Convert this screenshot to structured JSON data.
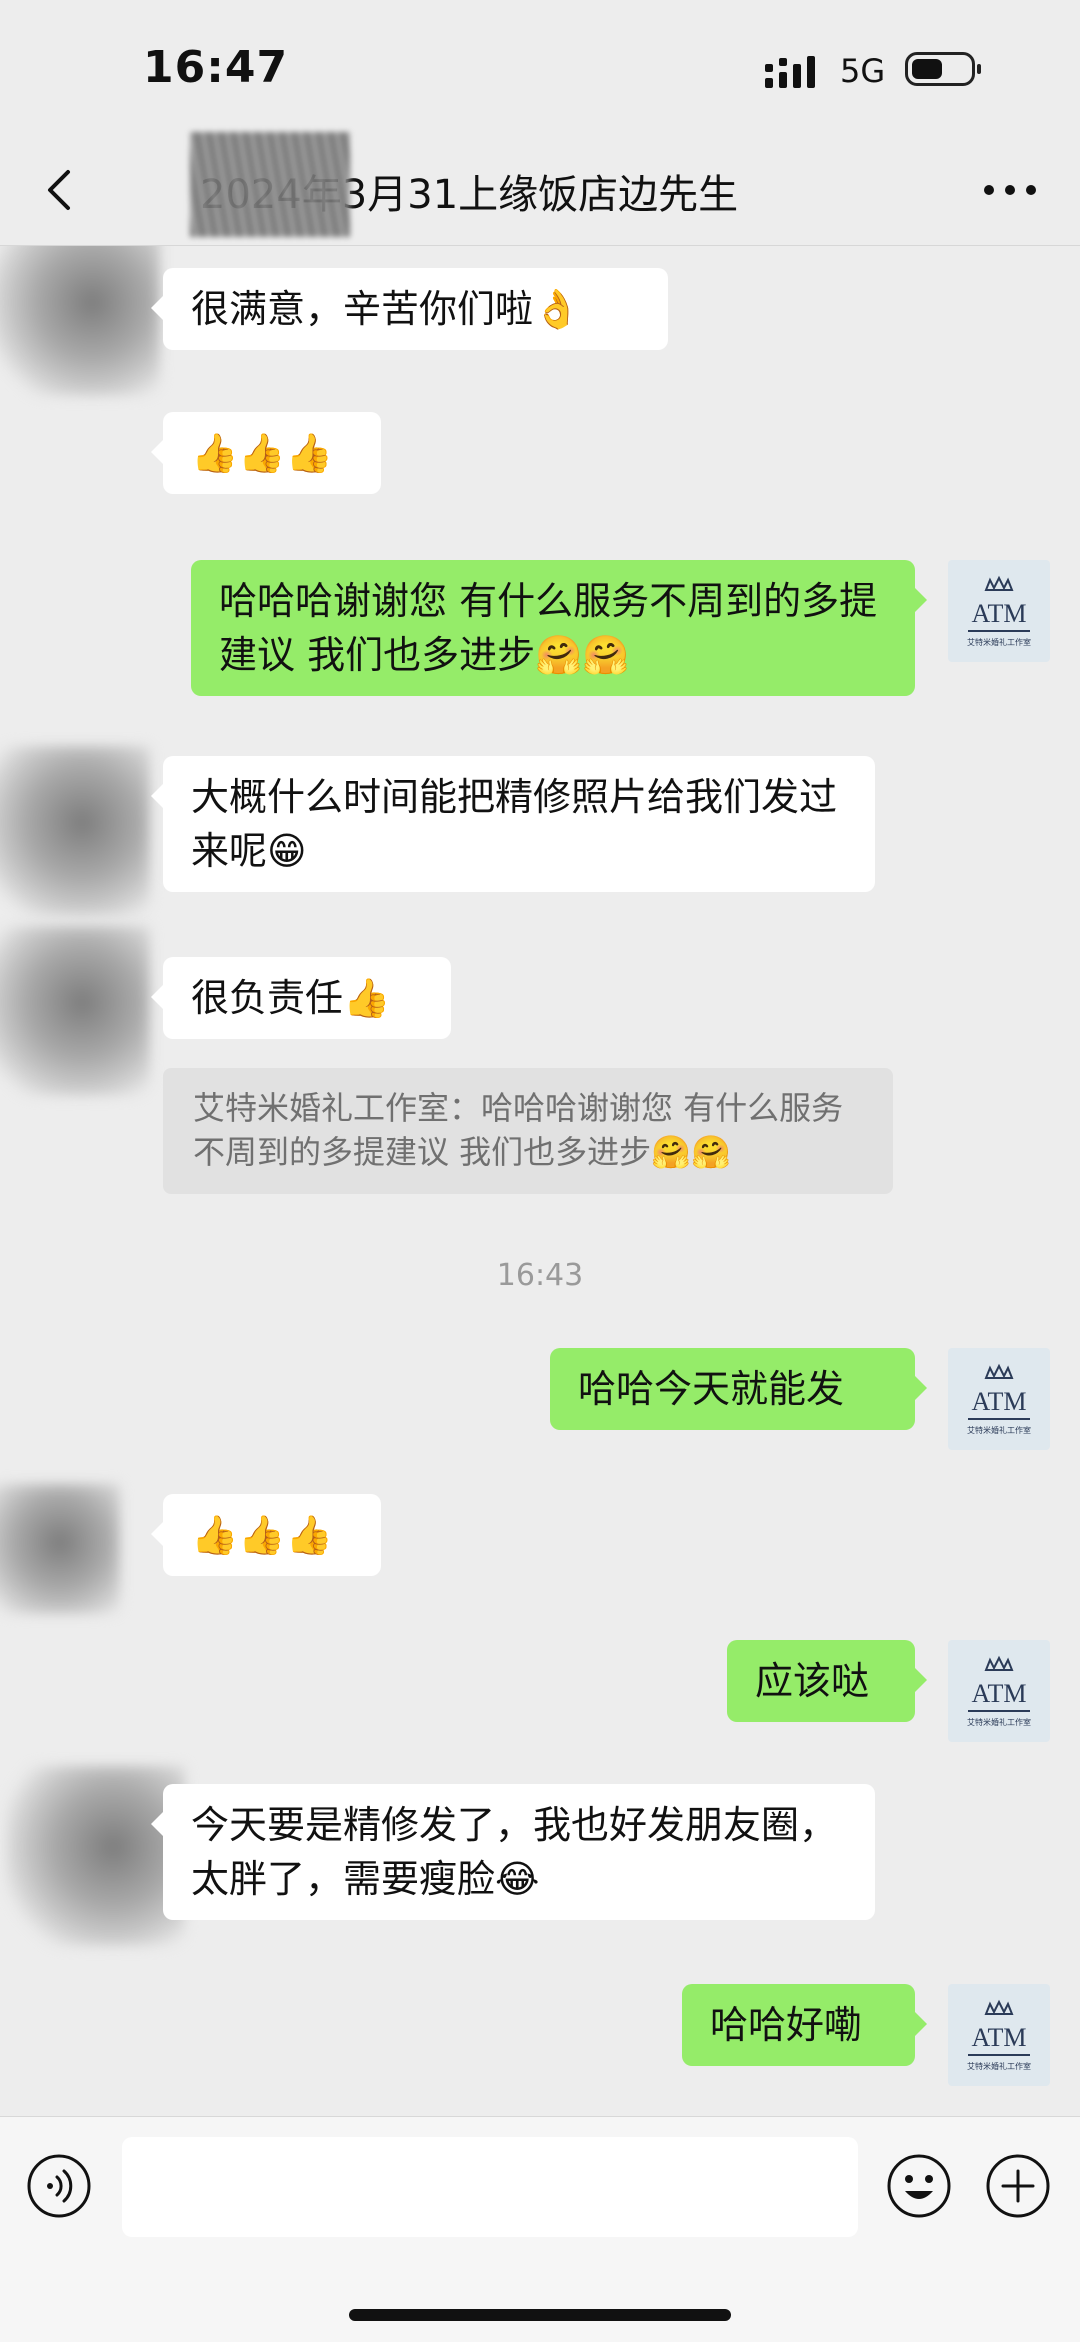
{
  "status": {
    "time": "16:47",
    "network": "5G"
  },
  "header": {
    "title": "2024年3月31上缘饭店边先生"
  },
  "avatar_logo": {
    "monogram": "ATM",
    "caption": "艾特米婚礼工作室"
  },
  "messages": {
    "m1": {
      "text": "很满意，辛苦你们啦👌"
    },
    "m2": {
      "text": "👍👍👍"
    },
    "m3": {
      "text": "哈哈哈谢谢您 有什么服务不周到的多提建议 我们也多进步🤗🤗"
    },
    "m4": {
      "text": "大概什么时间能把精修照片给我们发过来呢😁"
    },
    "m5": {
      "text": "很负责任👍"
    },
    "quote": {
      "text": "艾特米婚礼工作室：哈哈哈谢谢您 有什么服务不周到的多提建议 我们也多进步🤗🤗"
    },
    "timestamp": "16:43",
    "m6": {
      "text": "哈哈今天就能发"
    },
    "m7": {
      "text": "👍👍👍"
    },
    "m8": {
      "text": "应该哒"
    },
    "m9": {
      "text": "今天要是精修发了，我也好发朋友圈，太胖了，需要瘦脸😂"
    },
    "m10": {
      "text": "哈哈好嘞"
    }
  },
  "input": {
    "value": "",
    "placeholder": ""
  },
  "colors": {
    "sent_bubble": "#95ec69",
    "received_bubble": "#ffffff",
    "chat_bg": "#ededed"
  },
  "icons": [
    "signal-icon",
    "battery-icon",
    "back-icon",
    "more-icon",
    "voice-icon",
    "emoji-icon",
    "plus-icon"
  ]
}
